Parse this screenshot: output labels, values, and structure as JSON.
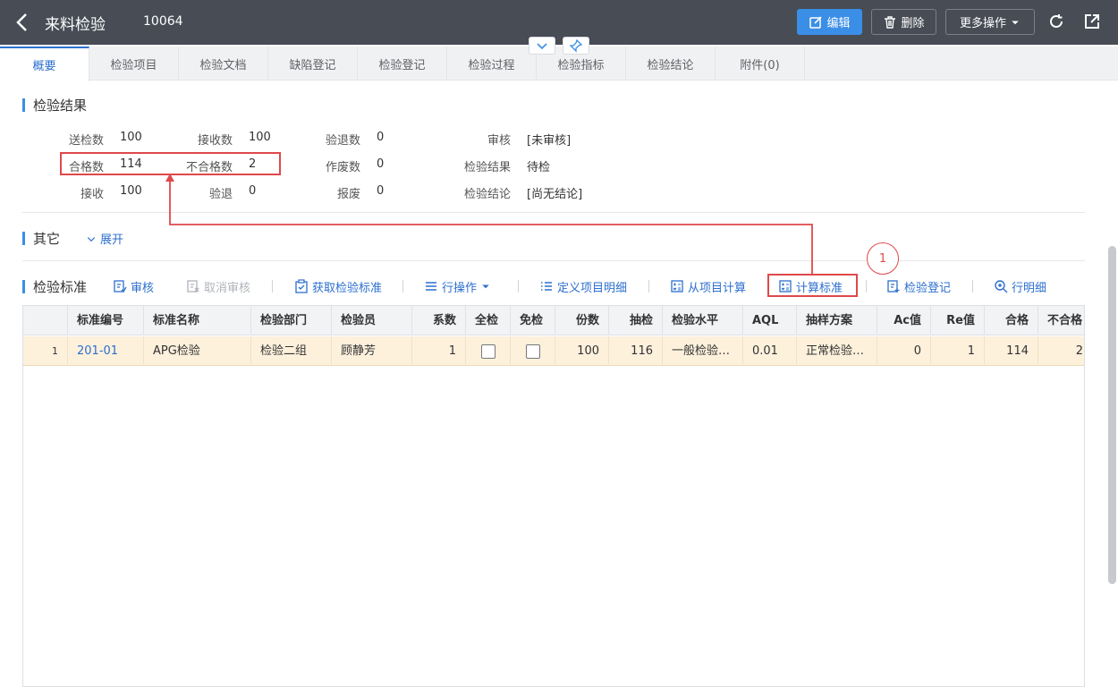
{
  "header": {
    "title": "来料检验",
    "doc_no": "10064",
    "edit_label": "编辑",
    "delete_label": "删除",
    "more_label": "更多操作"
  },
  "tabs": [
    {
      "label": "概要"
    },
    {
      "label": "检验项目"
    },
    {
      "label": "检验文档"
    },
    {
      "label": "缺陷登记"
    },
    {
      "label": "检验登记"
    },
    {
      "label": "检验过程"
    },
    {
      "label": "检验指标"
    },
    {
      "label": "检验结论"
    },
    {
      "label": "附件(0)"
    }
  ],
  "result": {
    "title": "检验结果",
    "fields": [
      {
        "k": "送检数",
        "v": "100"
      },
      {
        "k": "接收数",
        "v": "100"
      },
      {
        "k": "验退数",
        "v": "0"
      },
      {
        "k": "审核",
        "v": "[未审核]"
      },
      {
        "k": "合格数",
        "v": "114"
      },
      {
        "k": "不合格数",
        "v": "2"
      },
      {
        "k": "作废数",
        "v": "0"
      },
      {
        "k": "检验结果",
        "v": "待检"
      },
      {
        "k": "接收",
        "v": "100"
      },
      {
        "k": "验退",
        "v": "0"
      },
      {
        "k": "报废",
        "v": "0"
      },
      {
        "k": "检验结论",
        "v": "[尚无结论]"
      }
    ]
  },
  "other": {
    "title": "其它",
    "expand_label": "展开"
  },
  "standard": {
    "title": "检验标准",
    "toolbar": {
      "audit": "审核",
      "unaudit": "取消审核",
      "fetch": "获取检验标准",
      "row_ops": "行操作",
      "define": "定义项目明细",
      "from_item": "从项目计算",
      "calc": "计算标准",
      "register": "检验登记",
      "row_detail": "行明细"
    },
    "columns": [
      "标准编号",
      "标准名称",
      "检验部门",
      "检验员",
      "系数",
      "全检",
      "免检",
      "份数",
      "抽检",
      "检验水平",
      "AQL",
      "抽样方案",
      "Ac值",
      "Re值",
      "合格",
      "不合格"
    ],
    "rows": [
      {
        "no": "1",
        "code": "201-01",
        "name": "APG检验",
        "dept": "检验二组",
        "inspector": "顾静芳",
        "coef": "1",
        "full": false,
        "exempt": false,
        "copies": "100",
        "sample": "116",
        "level": "一般检验…",
        "aql": "0.01",
        "plan": "正常检验…",
        "ac": "0",
        "re": "1",
        "pass": "114",
        "fail": "2"
      }
    ]
  },
  "annotation": {
    "callout": "1"
  }
}
